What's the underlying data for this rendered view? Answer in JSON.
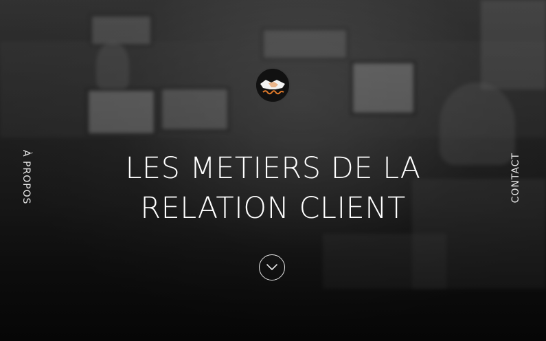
{
  "hero": {
    "title_line1": "LES METIERS DE LA",
    "title_line2": "RELATION CLIENT"
  },
  "nav": {
    "left_label": "À PROPOS",
    "right_label": "CONTACT"
  },
  "logo": {
    "icon": "handshake-logo",
    "accent": "#e07a2a"
  },
  "scroll_button": {
    "icon": "chevron-down-icon"
  }
}
